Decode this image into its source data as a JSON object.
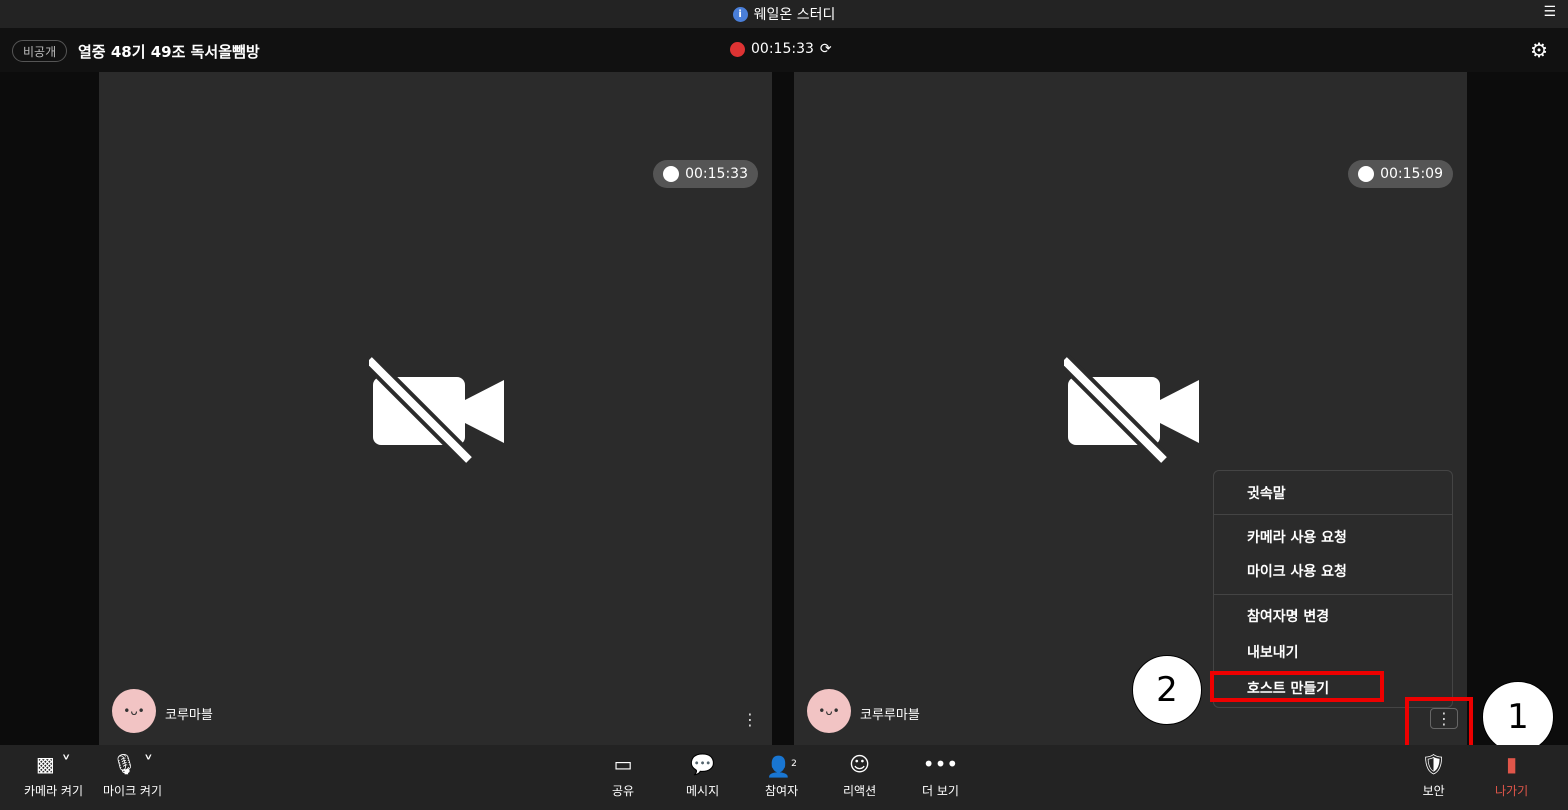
{
  "window": {
    "title": "웨일온 스터디"
  },
  "header": {
    "visibility": "비공개",
    "room": "열중 48기 49조 독서올뺌방",
    "timer": "00:15:33"
  },
  "tiles": [
    {
      "timer": "00:15:33",
      "name": "코루마블"
    },
    {
      "timer": "00:15:09",
      "name": "코루루마블"
    }
  ],
  "menu": {
    "items": [
      "귓속말",
      "카메라 사용 요청",
      "마이크 사용 요청",
      "참여자명 변경",
      "내보내기",
      "호스트 만들기"
    ]
  },
  "annotations": {
    "one": "1",
    "two": "2"
  },
  "toolbar": {
    "camera": "카메라 켜기",
    "mic": "마이크 켜기",
    "share": "공유",
    "message": "메시지",
    "participants": "참여자",
    "participants_count": "2",
    "reaction": "리액션",
    "more": "더 보기",
    "security": "보안",
    "leave": "나가기"
  },
  "colors": {
    "accent_red": "#e00000",
    "leave": "#e0564a"
  }
}
